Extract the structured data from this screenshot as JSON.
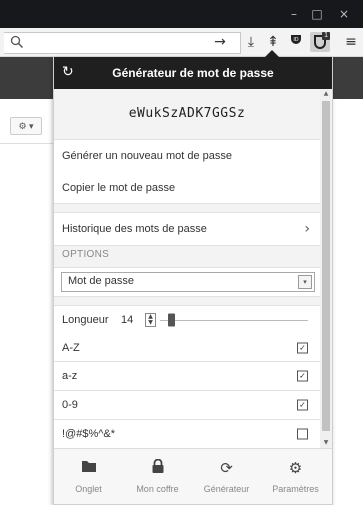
{
  "window": {
    "minimize_glyph": "–",
    "maximize_glyph": "□",
    "close_glyph": "×"
  },
  "toolbar": {
    "search_icon": "⚲",
    "go_glyph": "→",
    "download_glyph": "⤓",
    "library_glyph": "⇞",
    "pocket_glyph": "⛉",
    "extension_badge": "1",
    "menu_glyph": "≡"
  },
  "page": {
    "gear_button": "⚙ ▾"
  },
  "popup": {
    "header": {
      "title": "Générateur de mot de passe",
      "refresh_glyph": "↻"
    },
    "generated_password": "eWukSzADK7GGSz",
    "actions": [
      {
        "label": "Générer un nouveau mot de passe"
      },
      {
        "label": "Copier le mot de passe"
      }
    ],
    "history": {
      "label": "Historique des mots de passe",
      "chevron": "›"
    },
    "options": {
      "section_label": "OPTIONS",
      "type_select": {
        "value": "Mot de passe",
        "dropdown_glyph": "▾"
      },
      "length": {
        "label": "Longueur",
        "value": "14",
        "slider_fraction": 0.05
      },
      "charsets": [
        {
          "label": "A-Z",
          "checked": true
        },
        {
          "label": "a-z",
          "checked": true
        },
        {
          "label": "0-9",
          "checked": true
        },
        {
          "label": "!@#$%^&*",
          "checked": false
        }
      ]
    },
    "scrollbar": {
      "up": "▲",
      "down": "▼"
    },
    "tabs": [
      {
        "icon": "folder-icon",
        "glyph": "▬",
        "label": "Onglet"
      },
      {
        "icon": "lock-icon",
        "glyph": "🔒︎",
        "label": "Mon coffre"
      },
      {
        "icon": "refresh-icon",
        "glyph": "⟳",
        "label": "Générateur"
      },
      {
        "icon": "cogs-icon",
        "glyph": "⚙",
        "label": "Paramètres"
      }
    ],
    "colors": {
      "header_bg": "#1f1f1f",
      "panel_bg": "#f3f3f3"
    }
  }
}
